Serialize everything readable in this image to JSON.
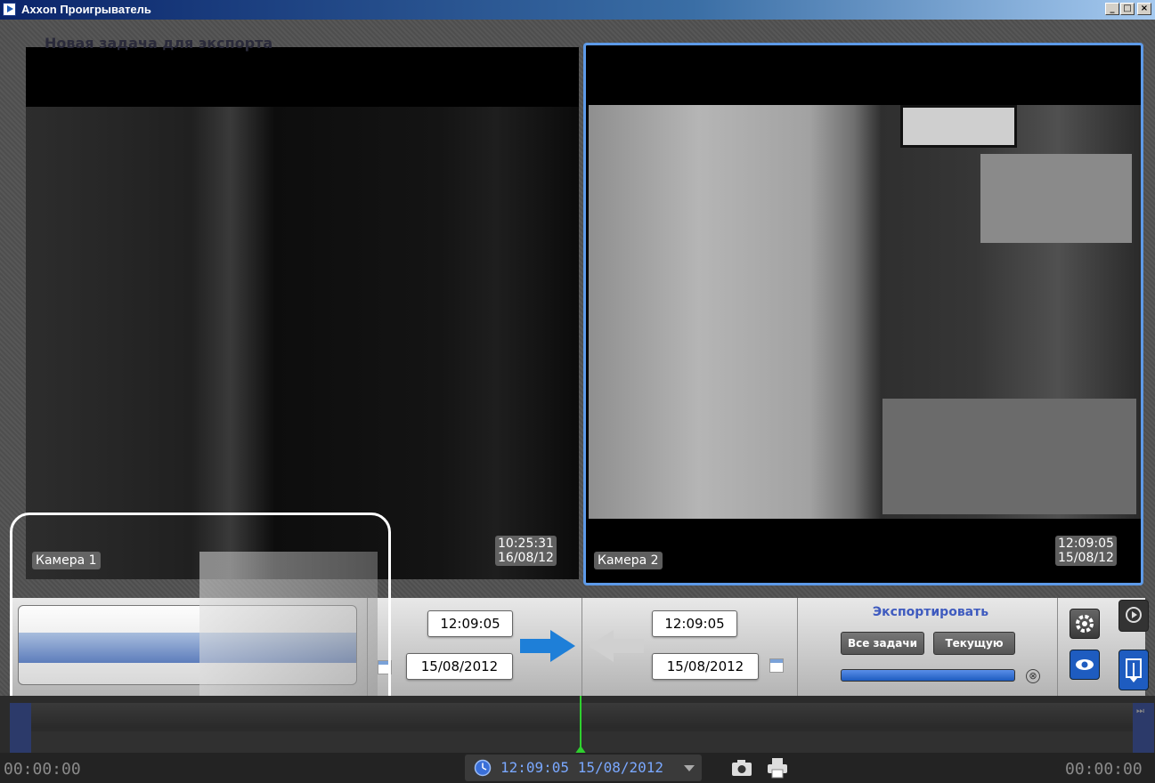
{
  "window": {
    "title": "Axxon Проигрыватель",
    "minimize": "_",
    "maximize": "□",
    "close": "×"
  },
  "cameras": [
    {
      "label": "Камера 1",
      "time": "10:25:31",
      "date": "16/08/12"
    },
    {
      "label": "Камера 2",
      "time": "12:09:05",
      "date": "15/08/12"
    }
  ],
  "export_panel": {
    "task_label": "Новая задача для экспорта",
    "start_time": "12:09:05",
    "start_date": "15/08/2012",
    "end_time": "12:09:05",
    "end_date": "15/08/2012",
    "export_title": "Экспортировать",
    "all_tasks_label": "Все задачи",
    "current_label": "Текущую",
    "progress_fraction": 1.0,
    "cancel_glyph": "⊗"
  },
  "timeline": {
    "left_time": "00:00:00",
    "right_time": "00:00:00",
    "current_time": "12:09:05",
    "current_date": "15/08/2012",
    "skip_glyph": "⏭"
  },
  "colors": {
    "accent": "#5d9ae8",
    "export_title": "#3f5bbf",
    "cursor": "#2fd02f"
  }
}
